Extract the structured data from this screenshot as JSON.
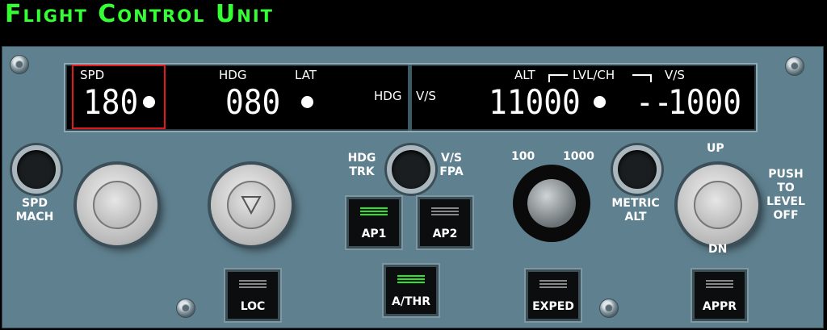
{
  "title": "Flight Control Unit",
  "display": {
    "spd_label": "SPD",
    "spd_value": "180",
    "hdg_label": "HDG",
    "lat_label": "LAT",
    "hdg_value": "080",
    "hdg_mode": "HDG",
    "vs_mode": "V/S",
    "alt_label": "ALT",
    "lvlch_label": "LVL/CH",
    "vs_label": "V/S",
    "alt_value": "11000",
    "vs_dash": "--",
    "vs_value": "1000"
  },
  "panel": {
    "spd_mach": "SPD\nMACH",
    "hdg_trk": "HDG\nTRK",
    "vs_fpa": "V/S\nFPA",
    "alt_100": "100",
    "alt_1000": "1000",
    "metric_alt": "METRIC\nALT",
    "up": "UP",
    "dn": "DN",
    "push_level": "PUSH\nTO\nLEVEL\nOFF"
  },
  "buttons": {
    "ap1": "AP1",
    "ap2": "AP2",
    "loc": "LOC",
    "athr": "A/THR",
    "exped": "EXPED",
    "appr": "APPR"
  },
  "colors": {
    "title": "#33ff33",
    "panel": "#5f808f",
    "active_light": "#29e629",
    "selection_box": "#e01a1a"
  }
}
